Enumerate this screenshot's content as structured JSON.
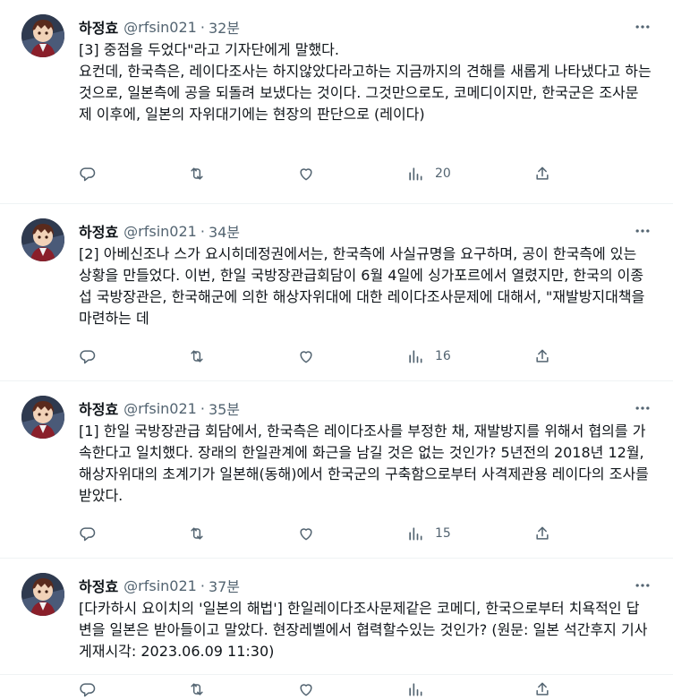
{
  "tweets": [
    {
      "name": "하정효",
      "handle": "@rfsin021",
      "dot": "·",
      "time": "32분",
      "text": "[3] 중점을 두었다\"라고 기자단에게 말했다.\n요컨데, 한국측은, 레이다조사는 하지않았다라고하는 지금까지의 견해를 새롭게 나타냈다고 하는 것으로, 일본측에 공을 되돌려 보냈다는 것이다. 그것만으로도, 코메디이지만, 한국군은 조사문제 이후에, 일본의 자위대기에는 현장의 판단으로 (레이다)",
      "views": "20"
    },
    {
      "name": "하정효",
      "handle": "@rfsin021",
      "dot": "·",
      "time": "34분",
      "text": "[2] 아베신조나 스가 요시히데정권에서는, 한국측에 사실규명을 요구하며, 공이 한국측에 있는 상황을 만들었다. 이번, 한일 국방장관급회담이 6월 4일에 싱가포르에서 열렸지만, 한국의 이종섭 국방장관은, 한국해군에 의한 해상자위대에 대한 레이다조사문제에 대해서, \"재발방지대책을 마련하는 데",
      "views": "16"
    },
    {
      "name": "하정효",
      "handle": "@rfsin021",
      "dot": "·",
      "time": "35분",
      "text": "[1] 한일 국방장관급 회담에서, 한국측은 레이다조사를 부정한 채, 재발방지를 위해서 협의를 가속한다고 일치했다. 장래의 한일관계에 화근을 남길 것은 없는 것인가? 5년전의 2018년 12월, 해상자위대의 초계기가 일본해(동해)에서 한국군의 구축함으로부터 사격제관용 레이다의 조사를 받았다.",
      "views": "15"
    },
    {
      "name": "하정효",
      "handle": "@rfsin021",
      "dot": "·",
      "time": "37분",
      "text": "[다카하시 요이치의 '일본의 해법'] 한일레이다조사문제같은 코메디, 한국으로부터 치욕적인 답변을 일본은 받아들이고 말았다. 현장레벨에서 협력할수있는 것인가? (원문: 일본 석간후지 기사게재시각: 2023.06.09 11:30)",
      "views": ""
    }
  ],
  "icons": {
    "more": "more-horizontal-icon",
    "reply": "reply-icon",
    "retweet": "retweet-icon",
    "like": "heart-icon",
    "views": "views-icon",
    "share": "share-icon"
  },
  "colors": {
    "text": "#0f1419",
    "secondary": "#536471",
    "divider": "#eff3f4"
  }
}
